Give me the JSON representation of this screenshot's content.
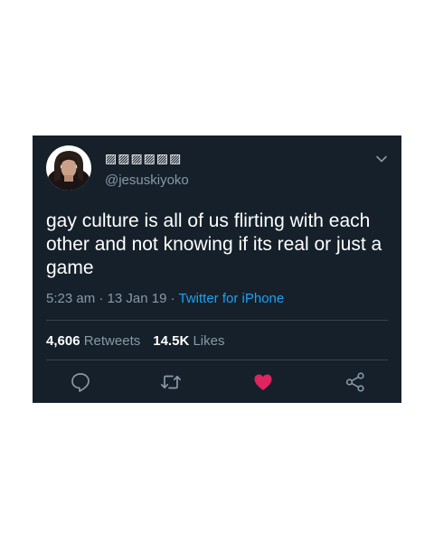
{
  "tweet": {
    "display_name": "▨▨▨▨▨▨",
    "handle": "@jesuskiyoko",
    "text": "gay culture is all of us flirting with each other and not knowing if its real or just a game",
    "time": "5:23 am",
    "separator": " · ",
    "date": "13 Jan 19",
    "source": "Twitter for iPhone",
    "retweets_count": "4,606",
    "retweets_label": "Retweets",
    "likes_count": "14.5K",
    "likes_label": "Likes"
  },
  "icons": {
    "chevron": "chevron-down-icon",
    "reply": "reply-icon",
    "retweet": "retweet-icon",
    "like": "heart-icon",
    "share": "share-icon"
  },
  "colors": {
    "background": "#15202b",
    "secondary_text": "#8899a6",
    "link": "#1da1f2",
    "like": "#e0245e",
    "divider": "#38444d"
  }
}
